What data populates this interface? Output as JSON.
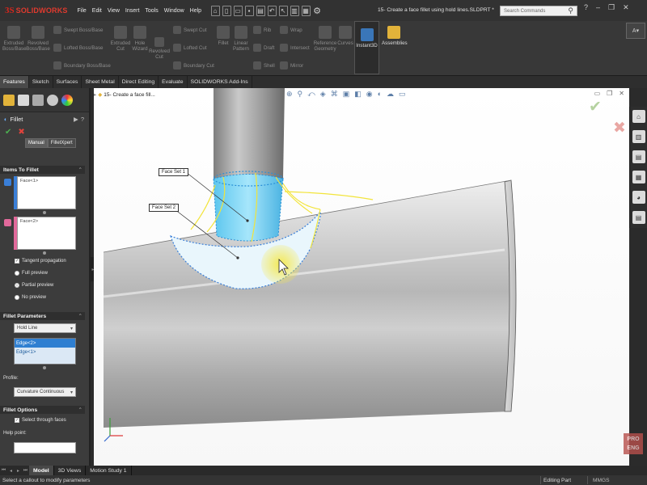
{
  "app": {
    "logo_text": "SOLIDWORKS",
    "document_title": "15- Create a face fillet using hold lines.SLDPRT *",
    "search_placeholder": "Search Commands"
  },
  "menu": [
    "File",
    "Edit",
    "View",
    "Insert",
    "Tools",
    "Window",
    "Help"
  ],
  "ribbon": {
    "extruded_boss": "Extruded\nBoss/Base",
    "revolved_boss": "Revolved\nBoss/Base",
    "swept_boss": "Swept Boss/Base",
    "lofted_boss": "Lofted Boss/Base",
    "boundary_boss": "Boundary Boss/Base",
    "extruded_cut": "Extruded\nCut",
    "hole_wizard": "Hole\nWizard",
    "revolved_cut": "Revolved\nCut",
    "swept_cut": "Swept Cut",
    "lofted_cut": "Lofted Cut",
    "boundary_cut": "Boundary Cut",
    "fillet": "Fillet",
    "linear_pattern": "Linear\nPattern",
    "rib": "Rib",
    "draft": "Draft",
    "shell": "Shell",
    "wrap": "Wrap",
    "intersect": "Intersect",
    "mirror": "Mirror",
    "reference_geometry": "Reference\nGeometry",
    "curves": "Curves",
    "instant3d": "Instant3D",
    "assemblies": "Assemblies"
  },
  "tabs": [
    "Features",
    "Sketch",
    "Surfaces",
    "Sheet Metal",
    "Direct Editing",
    "Evaluate",
    "SOLIDWORKS Add-Ins"
  ],
  "property_manager": {
    "title": "Fillet",
    "mode_tabs": [
      "Manual",
      "FilletXpert"
    ],
    "items_section": "Items To Fillet",
    "face_set_1_item": "Face<1>",
    "face_set_2_item": "Face<2>",
    "tangent_propagation": "Tangent propagation",
    "full_preview": "Full preview",
    "partial_preview": "Partial preview",
    "no_preview": "No preview",
    "params_section": "Fillet Parameters",
    "method": "Hold Line",
    "edges": [
      "Edge<2>",
      "Edge<1>"
    ],
    "profile_label": "Profile:",
    "profile_value": "Curvature Continuous",
    "options_section": "Fillet Options",
    "select_through_faces": "Select through faces",
    "help_point_label": "Help point:"
  },
  "viewport": {
    "tree_label": "15- Create a face fill...",
    "callout_1": "Face Set 1",
    "callout_2": "Face Set 2"
  },
  "badge": {
    "line1": "PRO",
    "line2": "ENG"
  },
  "bottom_tabs": [
    "Model",
    "3D Views",
    "Motion Study 1"
  ],
  "status": {
    "message": "Select a callout to modify parameters",
    "mode": "Editing Part",
    "units": "MMGS"
  },
  "colors": {
    "face_set_1": "#3a7fd8",
    "face_set_2": "#e2699b",
    "hold_line": "#f2e43a",
    "preview_fill": "#6fd0f0"
  }
}
